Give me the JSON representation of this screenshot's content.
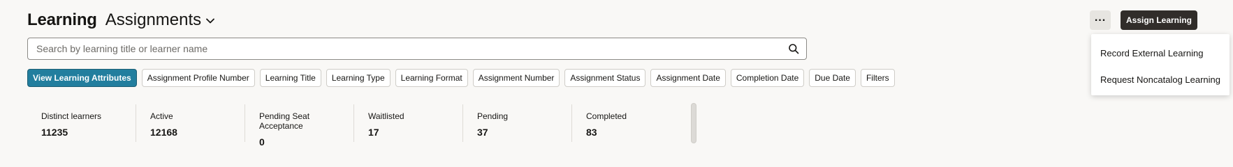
{
  "header": {
    "title": "Learning",
    "subtitle": "Assignments"
  },
  "search": {
    "placeholder": "Search by learning title or learner name"
  },
  "chips": [
    "View Learning Attributes",
    "Assignment Profile Number",
    "Learning Title",
    "Learning Type",
    "Learning Format",
    "Assignment Number",
    "Assignment Status",
    "Assignment Date",
    "Completion Date",
    "Due Date",
    "Filters"
  ],
  "metrics": [
    {
      "label": "Distinct learners",
      "value": "11235"
    },
    {
      "label": "Active",
      "value": "12168"
    },
    {
      "label": "Pending Seat Acceptance",
      "value": "0"
    },
    {
      "label": "Waitlisted",
      "value": "17"
    },
    {
      "label": "Pending",
      "value": "37"
    },
    {
      "label": "Completed",
      "value": "83"
    }
  ],
  "actions": {
    "more_label": "...",
    "assign_label": "Assign Learning"
  },
  "menu": {
    "items": [
      "Record External Learning",
      "Request Noncatalog Learning"
    ]
  },
  "colors": {
    "accent": "#227e9e",
    "primary_button": "#312d2a",
    "background": "#f9f8f6"
  },
  "icons": {
    "dropdown": "chevron-down-icon",
    "search": "search-icon"
  }
}
